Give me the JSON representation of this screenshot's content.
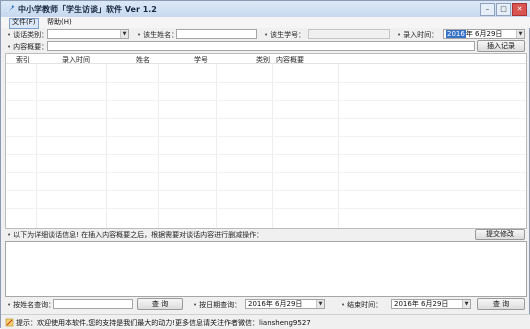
{
  "window": {
    "title": "中小学教师「学生访谈」软件 Ver 1.2"
  },
  "menu": [
    {
      "label": "文件(F)"
    },
    {
      "label": "帮助(H)"
    }
  ],
  "form": {
    "category_label": "谈话类别：",
    "category_value": "",
    "name_label": "该生姓名：",
    "name_value": "",
    "student_id_label": "该生学号：",
    "student_id_value": "",
    "entry_time_label": "录入时间：",
    "entry_time_year": "2016",
    "entry_time_rest": "年  6月29日",
    "summary_label": "内容概要：",
    "summary_value": "",
    "insert_button": "插入记录"
  },
  "table": {
    "columns": [
      "索引",
      "录入时间",
      "姓名",
      "学号",
      "类别",
      "内容概要"
    ],
    "rows": []
  },
  "detail": {
    "info_text": "以下为详细谈话信息! 在插入内容概要之后，根据需要对谈话内容进行删减操作：",
    "submit_button": "提交修改",
    "detail_value": ""
  },
  "query": {
    "name_query_label": "按姓名查询：",
    "name_query_value": "",
    "name_query_button": "查 询",
    "date_query_label": "按日期查询：",
    "start_date": "2016年  6月29日",
    "end_time_label": "结束时间：",
    "end_date": "2016年  6月29日",
    "date_query_button": "查 询"
  },
  "status": {
    "prefix": "提示：",
    "message": "欢迎使用本软件,您的支持是我们最大的动力!更多信息请关注作者微信：liansheng9527"
  }
}
